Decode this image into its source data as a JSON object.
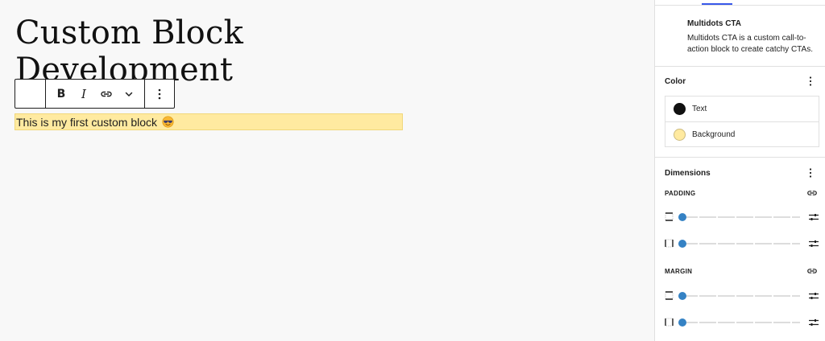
{
  "editor": {
    "post_title": "Custom Block Development",
    "cta_text": "This is my first custom block",
    "cta_emoji": "smiling-face-with-sunglasses-icon",
    "cta_background": "#ffeaa0"
  },
  "toolbar": {
    "bold_label": "B",
    "italic_label": "I",
    "icons": [
      "bold-icon",
      "italic-icon",
      "link-icon",
      "chevron-down-icon",
      "more-vertical-icon"
    ]
  },
  "sidebar": {
    "block": {
      "name": "Multidots CTA",
      "description": "Multidots CTA is a custom call-to-action block to create catchy CTAs."
    },
    "color": {
      "title": "Color",
      "items": [
        {
          "label": "Text",
          "swatch": "#111111"
        },
        {
          "label": "Background",
          "swatch": "#ffeaa0"
        }
      ]
    },
    "dimensions": {
      "title": "Dimensions",
      "padding_label": "PADDING",
      "margin_label": "MARGIN",
      "accent": "#3582c4"
    }
  }
}
